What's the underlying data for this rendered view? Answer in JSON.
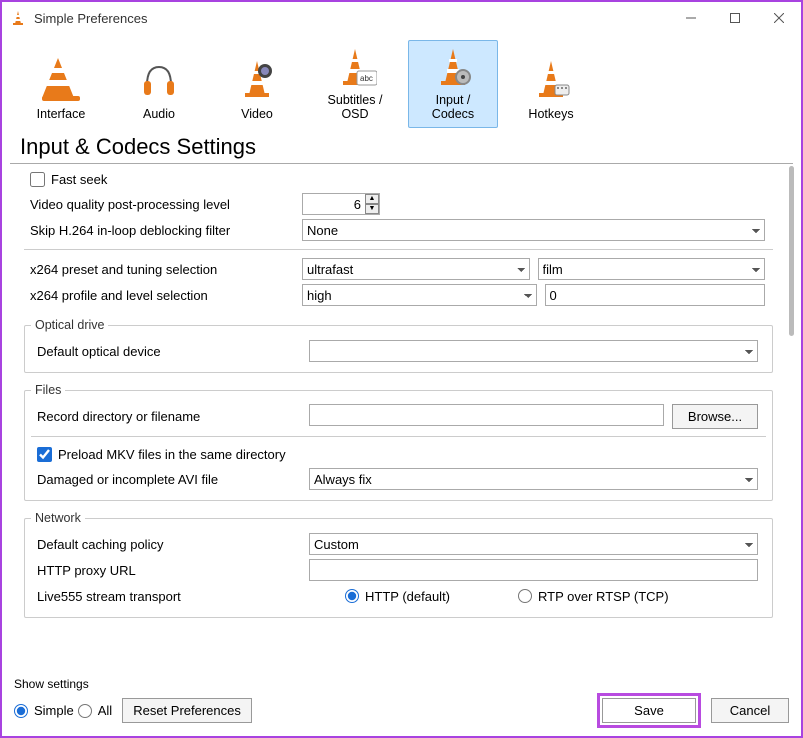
{
  "titlebar": {
    "title": "Simple Preferences"
  },
  "categories": [
    {
      "label": "Interface",
      "selected": false
    },
    {
      "label": "Audio",
      "selected": false
    },
    {
      "label": "Video",
      "selected": false
    },
    {
      "label": "Subtitles / OSD",
      "selected": false
    },
    {
      "label": "Input / Codecs",
      "selected": true
    },
    {
      "label": "Hotkeys",
      "selected": false
    }
  ],
  "page_heading": "Input & Codecs Settings",
  "codecs": {
    "fast_seek": {
      "label": "Fast seek",
      "checked": false
    },
    "video_quality": {
      "label": "Video quality post-processing level",
      "value": "6"
    },
    "skip_h264": {
      "label": "Skip H.264 in-loop deblocking filter",
      "value": "None"
    },
    "x264_preset_label": "x264 preset and tuning selection",
    "x264_preset": "ultrafast",
    "x264_tuning": "film",
    "x264_profile_label": "x264 profile and level selection",
    "x264_profile": "high",
    "x264_level": "0"
  },
  "optical": {
    "legend": "Optical drive",
    "default_device_label": "Default optical device",
    "default_device_value": ""
  },
  "files": {
    "legend": "Files",
    "record_dir_label": "Record directory or filename",
    "record_dir_value": "",
    "browse_label": "Browse...",
    "preload_mkv": {
      "label": "Preload MKV files in the same directory",
      "checked": true
    },
    "damaged_avi_label": "Damaged or incomplete AVI file",
    "damaged_avi_value": "Always fix"
  },
  "network": {
    "legend": "Network",
    "caching_label": "Default caching policy",
    "caching_value": "Custom",
    "http_proxy_label": "HTTP proxy URL",
    "http_proxy_value": "",
    "live555_label": "Live555 stream transport",
    "live555_http": "HTTP (default)",
    "live555_rtp": "RTP over RTSP (TCP)"
  },
  "footer": {
    "show_settings_label": "Show settings",
    "simple_label": "Simple",
    "all_label": "All",
    "reset_label": "Reset Preferences",
    "save_label": "Save",
    "cancel_label": "Cancel"
  }
}
